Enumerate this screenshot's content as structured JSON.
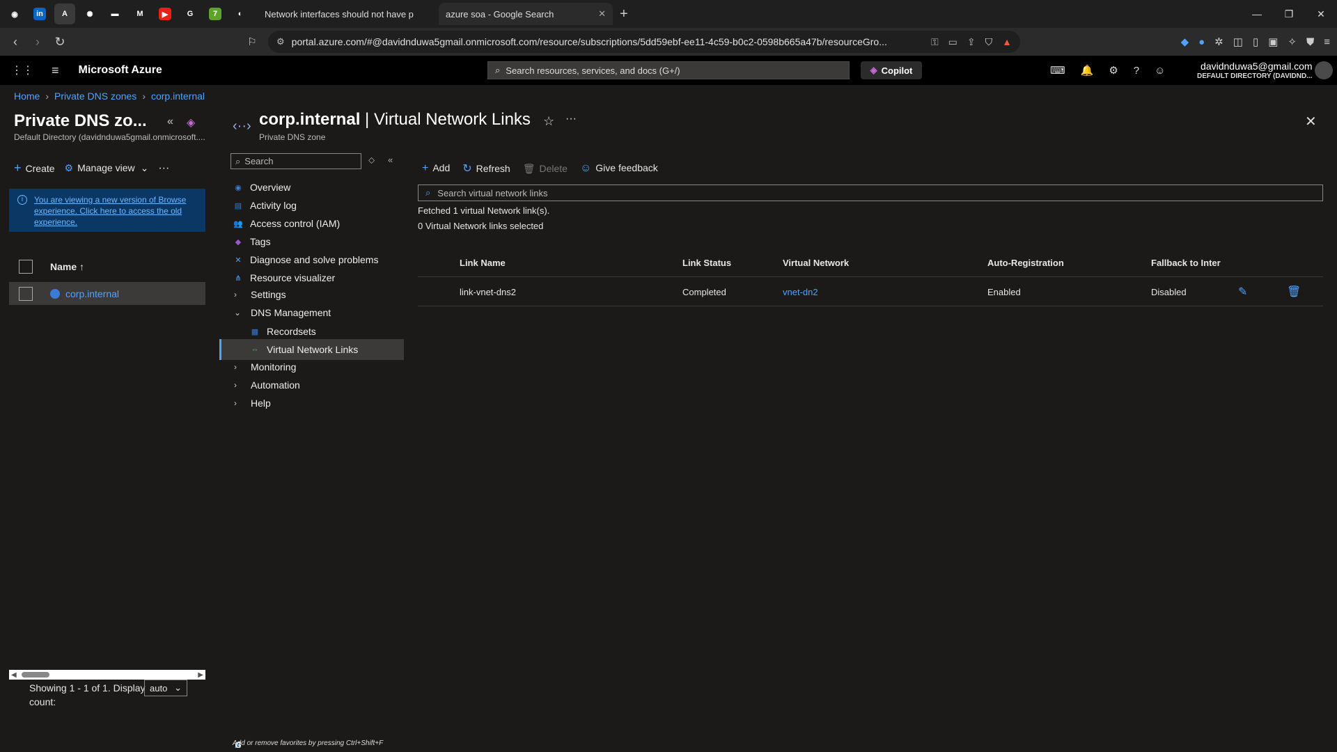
{
  "browser": {
    "pinned": [
      {
        "icon": "github-icon",
        "glyph": "◉",
        "bg": "#1f1f1f"
      },
      {
        "icon": "linkedin-icon",
        "glyph": "in",
        "bg": "#0a66c2"
      },
      {
        "icon": "azure-icon",
        "glyph": "A",
        "bg": "#3a3a3a"
      },
      {
        "icon": "openai-icon",
        "glyph": "✺",
        "bg": "#1f1f1f"
      },
      {
        "icon": "tray-icon",
        "glyph": "▬",
        "bg": "#1f1f1f"
      },
      {
        "icon": "medium-icon",
        "glyph": "M",
        "bg": "#1f1f1f"
      },
      {
        "icon": "youtube-icon",
        "glyph": "▶",
        "bg": "#e62117"
      },
      {
        "icon": "google-icon",
        "glyph": "G",
        "bg": "#1f1f1f"
      },
      {
        "icon": "seven-icon",
        "glyph": "7",
        "bg": "#5ea32a"
      },
      {
        "icon": "brave-icon",
        "glyph": "◐",
        "bg": "#1f1f1f"
      }
    ],
    "tabs": [
      {
        "title": "Network interfaces should not have p",
        "icon": "azure-icon"
      },
      {
        "title": "azure soa - Google Search",
        "icon": "google-icon"
      }
    ],
    "url": "portal.azure.com/#@davidnduwa5gmail.onmicrosoft.com/resource/subscriptions/5dd59ebf-ee11-4c59-b0c2-0598b665a47b/resourceGro..."
  },
  "portal": {
    "brand": "Microsoft Azure",
    "search_placeholder": "Search resources, services, and docs (G+/)",
    "copilot": "Copilot",
    "user_email": "davidnduwa5@gmail.com",
    "user_directory": "DEFAULT DIRECTORY (DAVIDND..."
  },
  "breadcrumb": [
    "Home",
    "Private DNS zones",
    "corp.internal"
  ],
  "left_panel": {
    "title": "Private DNS zo...",
    "subtitle": "Default Directory (davidnduwa5gmail.onmicrosoft....",
    "create": "Create",
    "manage_view": "Manage view",
    "info_text": "You are viewing a new version of Browse experience. Click here to access the old experience.",
    "col_name": "Name ↑",
    "rows": [
      "corp.internal"
    ],
    "showing": "Showing 1 - 1 of 1. Display count:",
    "display_count": "auto"
  },
  "blade": {
    "resource": "corp.internal",
    "page": "Virtual Network Links",
    "sep": " | ",
    "subtitle": "Private DNS zone",
    "menu_search": "Search",
    "menu": [
      {
        "label": "Overview",
        "icon": "overview-icon",
        "glyph": "◉",
        "color": "#3a7bd5"
      },
      {
        "label": "Activity log",
        "icon": "activity-log-icon",
        "glyph": "▤",
        "color": "#3a7bd5"
      },
      {
        "label": "Access control (IAM)",
        "icon": "iam-icon",
        "glyph": "👥",
        "color": "#3a7bd5"
      },
      {
        "label": "Tags",
        "icon": "tag-icon",
        "glyph": "◆",
        "color": "#9b59d0"
      },
      {
        "label": "Diagnose and solve problems",
        "icon": "wrench-icon",
        "glyph": "✕",
        "color": "#4fa3ff"
      },
      {
        "label": "Resource visualizer",
        "icon": "visualizer-icon",
        "glyph": "⋔",
        "color": "#4fa3ff"
      },
      {
        "label": "Settings",
        "chevron": "›"
      },
      {
        "label": "DNS Management",
        "chevron": "⌄"
      },
      {
        "label": "Recordsets",
        "icon": "recordsets-icon",
        "glyph": "▦",
        "color": "#3a7bd5",
        "sub": true
      },
      {
        "label": "Virtual Network Links",
        "icon": "vnet-link-icon",
        "glyph": "⇔",
        "color": "#5fb35f",
        "sub": true,
        "selected": true
      },
      {
        "label": "Monitoring",
        "chevron": "›"
      },
      {
        "label": "Automation",
        "chevron": "›"
      },
      {
        "label": "Help",
        "chevron": "›"
      }
    ],
    "fav_hint": "Add or remove favorites by pressing Ctrl+Shift+F"
  },
  "content": {
    "toolbar": {
      "add": "Add",
      "refresh": "Refresh",
      "delete": "Delete",
      "feedback": "Give feedback"
    },
    "search_placeholder": "Search virtual network links",
    "fetched": "Fetched 1 virtual Network link(s).",
    "selected": "0 Virtual Network links selected",
    "columns": [
      "Link Name",
      "Link Status",
      "Virtual Network",
      "Auto-Registration",
      "Fallback to Interr"
    ],
    "rows": [
      {
        "name": "link-vnet-dns2",
        "status": "Completed",
        "vnet": "vnet-dn2",
        "auto": "Enabled",
        "fallback": "Disabled"
      }
    ]
  }
}
